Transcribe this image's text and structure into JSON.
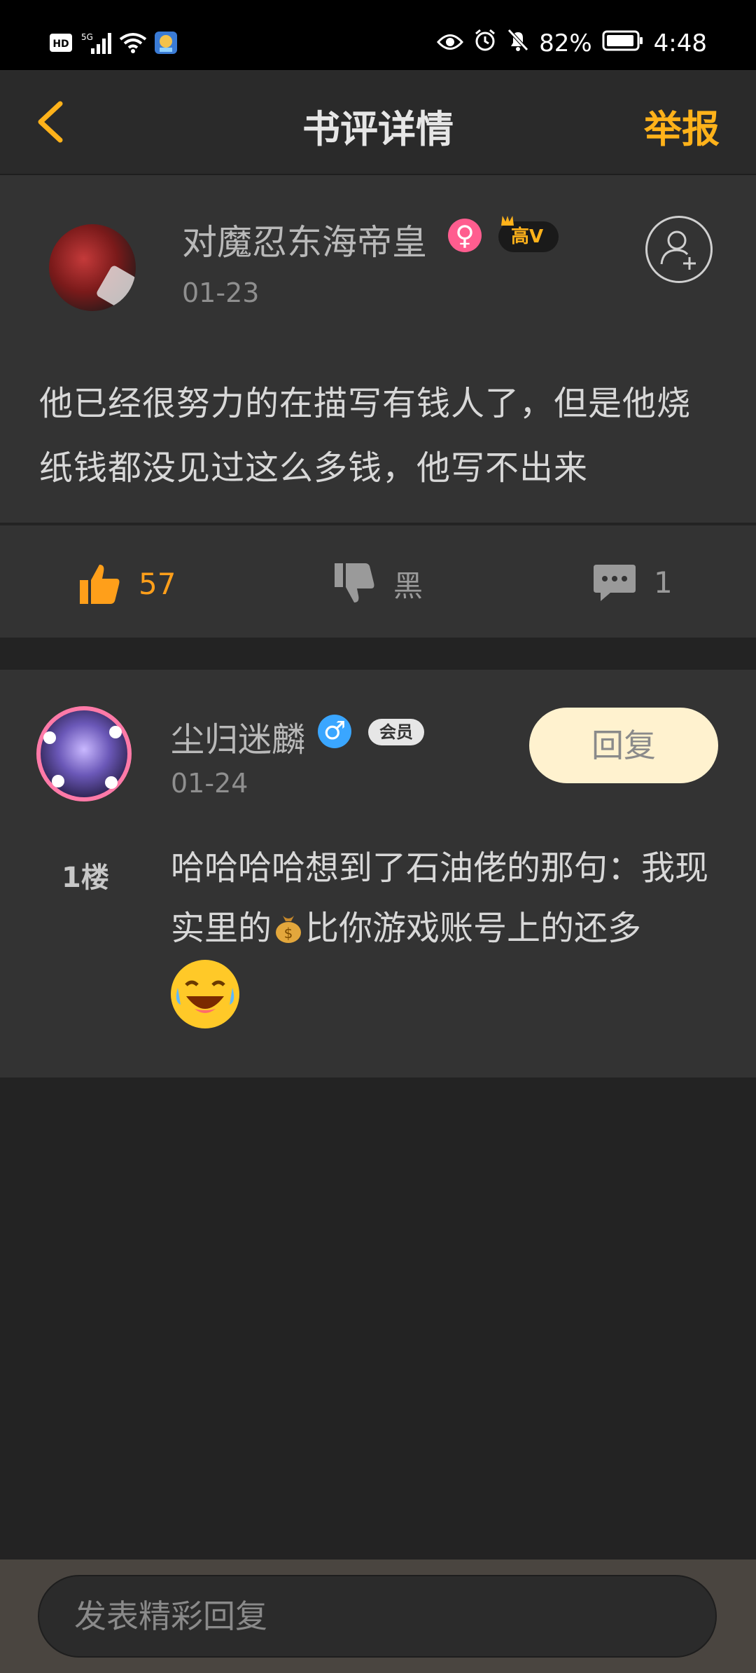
{
  "status_bar": {
    "battery": "82%",
    "time": "4:48",
    "network": "5G",
    "hd": "HD"
  },
  "header": {
    "title": "书评详情",
    "report_label": "举报",
    "accent": "#ffb21a"
  },
  "review": {
    "author": "对魔忍东海帝皇",
    "level_badge": "高V",
    "date": "01-23",
    "text": "他已经很努力的在描写有钱人了，但是他烧纸钱都没见过这么多钱，他写不出来"
  },
  "actions": {
    "likes": "57",
    "dislike_label": "黑",
    "comments": "1"
  },
  "reply": {
    "author": "尘归迷麟",
    "member_badge": "会员",
    "date": "01-24",
    "reply_button": "回复",
    "floor": "1楼",
    "text_before_emoji": "哈哈哈哈想到了石油佬的那句：我现实里的",
    "text_after_emoji": "比你游戏账号上的还多"
  },
  "composer": {
    "placeholder": "发表精彩回复"
  }
}
